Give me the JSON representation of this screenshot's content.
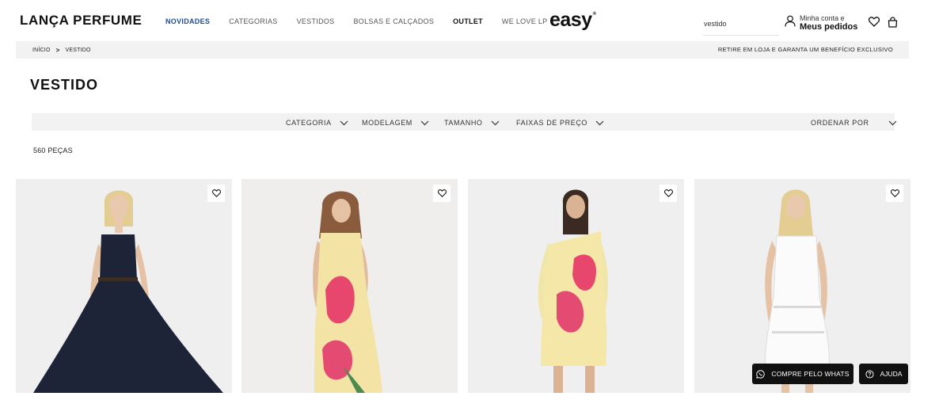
{
  "header": {
    "logo": "LANÇA PERFUME",
    "nav": [
      {
        "label": "NOVIDADES",
        "state": "active"
      },
      {
        "label": "CATEGORIAS",
        "state": "normal"
      },
      {
        "label": "VESTIDOS",
        "state": "normal"
      },
      {
        "label": "BOLSAS E CALÇADOS",
        "state": "normal"
      },
      {
        "label": "OUTLET",
        "state": "bold"
      },
      {
        "label": "WE LOVE LP",
        "state": "normal"
      }
    ],
    "easy_logo": "easy",
    "easy_mark": "®",
    "search_value": "vestido",
    "account_line1": "Minha conta e",
    "account_line2": "Meus pedidos",
    "icons": [
      "user-icon",
      "heart-icon",
      "bag-icon"
    ]
  },
  "breadcrumb": {
    "home": "INÍCIO",
    "separator": ">",
    "current": "VESTIDO"
  },
  "promo_text": "RETIRE EM LOJA E GARANTA UM BENEFÍCIO EXCLUSIVO",
  "page_title": "VESTIDO",
  "filters": [
    {
      "label": "CATEGORIA"
    },
    {
      "label": "MODELAGEM"
    },
    {
      "label": "TAMANHO"
    },
    {
      "label": "FAIXAS DE PREÇO"
    }
  ],
  "sort_label": "ORDENAR POR",
  "product_count": "560 PEÇAS",
  "products": [
    {
      "image": "navy-strappy-maxi-dress-photo"
    },
    {
      "image": "yellow-floral-midi-dress-photo"
    },
    {
      "image": "yellow-one-shoulder-floral-dress-photo"
    },
    {
      "image": "white-lace-slip-dress-photo"
    }
  ],
  "floating": {
    "whats_label": "COMPRE PELO WHATS",
    "help_label": "AJUDA"
  },
  "colors": {
    "accent_nav": "#1f4d8f",
    "dark": "#111111",
    "bar_bg": "#f2f2f2"
  }
}
